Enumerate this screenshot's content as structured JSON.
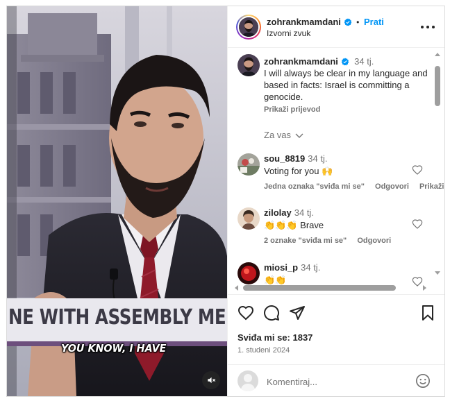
{
  "video": {
    "banner_text": "NE WITH ASSEMBLY MEM",
    "caption_text": "YOU KNOW, I HAVE",
    "mute_icon": "speaker-muted-icon"
  },
  "header": {
    "username": "zohrankmamdani",
    "verified_icon": "verified-badge-icon",
    "separator": "•",
    "follow_label": "Prati",
    "audio_label": "Izvorni zvuk",
    "more_icon": "more-options-icon"
  },
  "post": {
    "username": "zohrankmamdani",
    "time": "34 tj.",
    "text": "I will always be clear in my language and based in facts: Israel is committing a genocide.",
    "translate_label": "Prikaži prijevod"
  },
  "sort_label": "Za vas",
  "comments": [
    {
      "username": "sou_8819",
      "time": "34 tj.",
      "text": "Voting for you 🙌",
      "likes_label": "Jedna oznaka \"sviđa mi se\"",
      "reply_label": "Odgovori",
      "translate_label": "Prikaži"
    },
    {
      "username": "zilolay",
      "time": "34 tj.",
      "text": "👏👏👏 Brave",
      "likes_label": "2 oznake \"sviđa mi se\"",
      "reply_label": "Odgovori"
    },
    {
      "username": "miosi_p",
      "time": "34 tj.",
      "text": "👏👏"
    }
  ],
  "actions": {
    "likes_text": "Sviđa mi se: 1837",
    "date": "1. studeni 2024"
  },
  "comment_box": {
    "placeholder": "Komentiraj..."
  },
  "colors": {
    "accent": "#0095f6",
    "verified": "#0095f6",
    "muted_text": "#737373"
  }
}
